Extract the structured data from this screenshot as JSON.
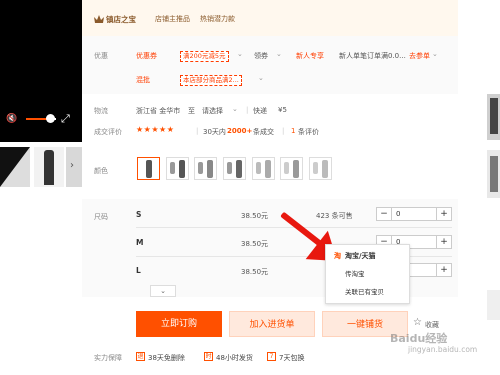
{
  "shop": {
    "title": "镇店之宝",
    "tag1": "店铺主推品",
    "tag2": "热销潜力款"
  },
  "promo": {
    "label": "优惠",
    "coupon_name": "优惠券",
    "coupon_text": "满200元减5元",
    "coupon_chev": "⌄",
    "claim": "领券",
    "newuser_badge": "新人专享",
    "newuser_text": "新人单笔订单满0.0...",
    "newuser_link": "去参单",
    "mix_name": "混批",
    "mix_text": "本店部分商品满2...",
    "chev": "⌄"
  },
  "shipping": {
    "label": "物流",
    "from": "浙江省 金华市",
    "to_word": "至",
    "to_select": "请选择",
    "express": "快递",
    "fee": "¥5"
  },
  "reviews": {
    "label": "成交评价",
    "stars": "★★★★★",
    "sales_prefix": "30天内",
    "sales_count": "2000+",
    "sales_suffix": "条成交",
    "review_count": "1",
    "review_suffix": "条评价"
  },
  "color": {
    "label": "颜色"
  },
  "size": {
    "label": "尺码",
    "rows": [
      {
        "name": "S",
        "price": "38.50元",
        "stock": "423 条可售",
        "qty": "0"
      },
      {
        "name": "M",
        "price": "38.50元",
        "stock": "",
        "qty": "0"
      },
      {
        "name": "L",
        "price": "38.50元",
        "stock": "",
        "qty": "0"
      }
    ],
    "minus": "−",
    "plus": "+",
    "collapse": "⌄"
  },
  "popup": {
    "icon": "淘",
    "head": "淘宝/天猫",
    "item1": "传淘宝",
    "item2": "关联已有宝贝"
  },
  "actions": {
    "order": "立即订购",
    "cart": "加入进货单",
    "list": "一键铺货",
    "fav": "收藏",
    "fav_icon": "☆"
  },
  "guarantee": {
    "label": "实力保障",
    "items": [
      {
        "badge": "退",
        "text": "38天免删除"
      },
      {
        "badge": "时",
        "text": "48小时发货"
      },
      {
        "badge": "7",
        "text": "7天包换"
      }
    ],
    "more": "⌄"
  },
  "watermark": {
    "line1": "Baidu经验",
    "line2": "jingyan.baidu.com"
  },
  "video": {
    "mute_icon": "🔇",
    "fs_icon": "⤢",
    "next_icon": "›"
  },
  "colors": {
    "accent": "#ff5000",
    "red": "#ff3d00",
    "arrow": "#e8180f"
  }
}
